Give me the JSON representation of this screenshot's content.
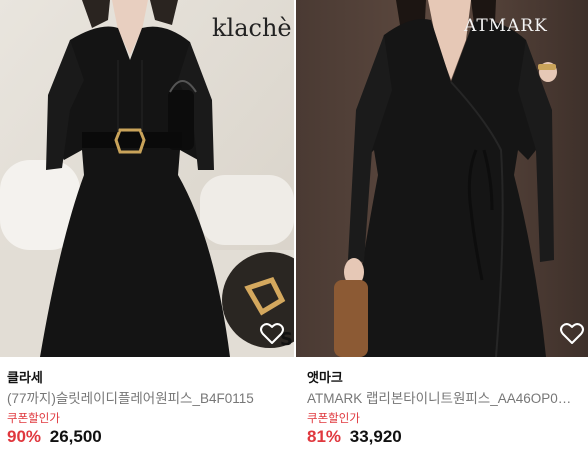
{
  "products": [
    {
      "brand_logo": "klachè",
      "store": "클라세",
      "title": "(77까지)슬릿레이디플레어원피스_B4F0115",
      "coupon": "쿠폰할인가",
      "discount": "90%",
      "price": "26,500",
      "heart_icon": "heart-outline-icon",
      "photo_icon": "product-photo-black-flare-dress"
    },
    {
      "brand_logo": "ATMARK",
      "store": "앳마크",
      "title": "ATMARK 랩리본타이니트원피스_AA46OP0…",
      "coupon": "쿠폰할인가",
      "discount": "81%",
      "price": "33,920",
      "heart_icon": "heart-outline-icon",
      "photo_icon": "product-photo-black-wrap-dress"
    }
  ],
  "colors": {
    "accent_red": "#e0383e",
    "text_dark": "#111111",
    "text_gray": "#777777"
  }
}
